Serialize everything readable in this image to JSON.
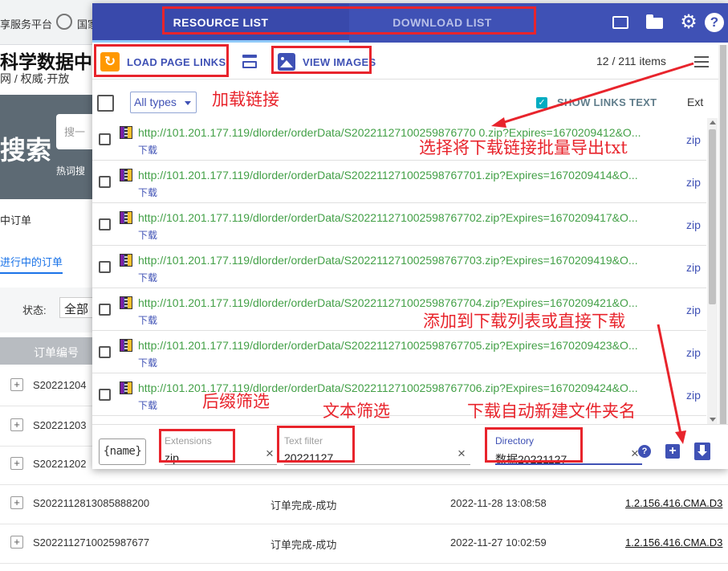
{
  "background": {
    "tab_text": "享服务平台",
    "tab_text2": "国家",
    "site_title": "科学数据中",
    "site_subtitle": "网 / 权威·开放",
    "banner_big": "搜索",
    "banner_search_placeholder": "搜一",
    "banner_hot": "热词搜",
    "my_orders": "中订单",
    "ongoing_tab": "进行中的订单",
    "status_label": "状态:",
    "status_value": "全部",
    "order_col": "订单编号",
    "rows": [
      {
        "id": "S20221204",
        "status": "",
        "time": "",
        "link": ""
      },
      {
        "id": "S20221203",
        "status": "",
        "time": "",
        "link": ""
      },
      {
        "id": "S20221202",
        "status": "",
        "time": "",
        "link": ""
      },
      {
        "id": "S2022112813085888200",
        "status": "订单完成-成功",
        "time": "2022-11-28 13:08:58",
        "link": "1.2.156.416.CMA.D3"
      },
      {
        "id": "S2022112710025987677",
        "status": "订单完成-成功",
        "time": "2022-11-27 10:02:59",
        "link": "1.2.156.416.CMA.D3"
      }
    ]
  },
  "popup": {
    "tabs": {
      "resource": "RESOURCE LIST",
      "download": "DOWNLOAD LIST"
    },
    "toolbar": {
      "load_label": "LOAD PAGE LINKS",
      "view_label": "VIEW IMAGES",
      "count_text": "12 / 211",
      "count_suffix": "items"
    },
    "list_header": {
      "type_filter": "All types",
      "show_links_text": "SHOW LINKS TEXT",
      "ext_header": "Ext"
    },
    "links": [
      {
        "url": "http://101.201.177.119/dlorder/orderData/S20221127100259876770 0.zip?Expires=1670209412&O...",
        "text": "下载",
        "ext": "zip"
      },
      {
        "url": "http://101.201.177.119/dlorder/orderData/S202211271002598767701.zip?Expires=1670209414&O...",
        "text": "下载",
        "ext": "zip"
      },
      {
        "url": "http://101.201.177.119/dlorder/orderData/S202211271002598767702.zip?Expires=1670209417&O...",
        "text": "下载",
        "ext": "zip"
      },
      {
        "url": "http://101.201.177.119/dlorder/orderData/S202211271002598767703.zip?Expires=1670209419&O...",
        "text": "下载",
        "ext": "zip"
      },
      {
        "url": "http://101.201.177.119/dlorder/orderData/S202211271002598767704.zip?Expires=1670209421&O...",
        "text": "下载",
        "ext": "zip"
      },
      {
        "url": "http://101.201.177.119/dlorder/orderData/S202211271002598767705.zip?Expires=1670209423&O...",
        "text": "下载",
        "ext": "zip"
      },
      {
        "url": "http://101.201.177.119/dlorder/orderData/S202211271002598767706.zip?Expires=1670209424&O...",
        "text": "下载",
        "ext": "zip"
      }
    ],
    "footer": {
      "name_button": "{name}",
      "extensions": {
        "label": "Extensions",
        "value": "zip"
      },
      "text_filter": {
        "label": "Text filter",
        "value": "20221127"
      },
      "directory": {
        "label": "Directory",
        "value": "数据20221127"
      }
    }
  },
  "annotations": {
    "load_links": "加载链接",
    "export_txt": "选择将下载链接批量导出txt",
    "add_download": "添加到下载列表或直接下载",
    "suffix_filter": "后缀筛选",
    "text_filter": "文本筛选",
    "auto_folder": "下载自动新建文件夹名"
  },
  "colors": {
    "header": "#3f51b5",
    "link_green": "#43a047",
    "annotation_red": "#e8242c",
    "load_icon": "#ff9800"
  }
}
